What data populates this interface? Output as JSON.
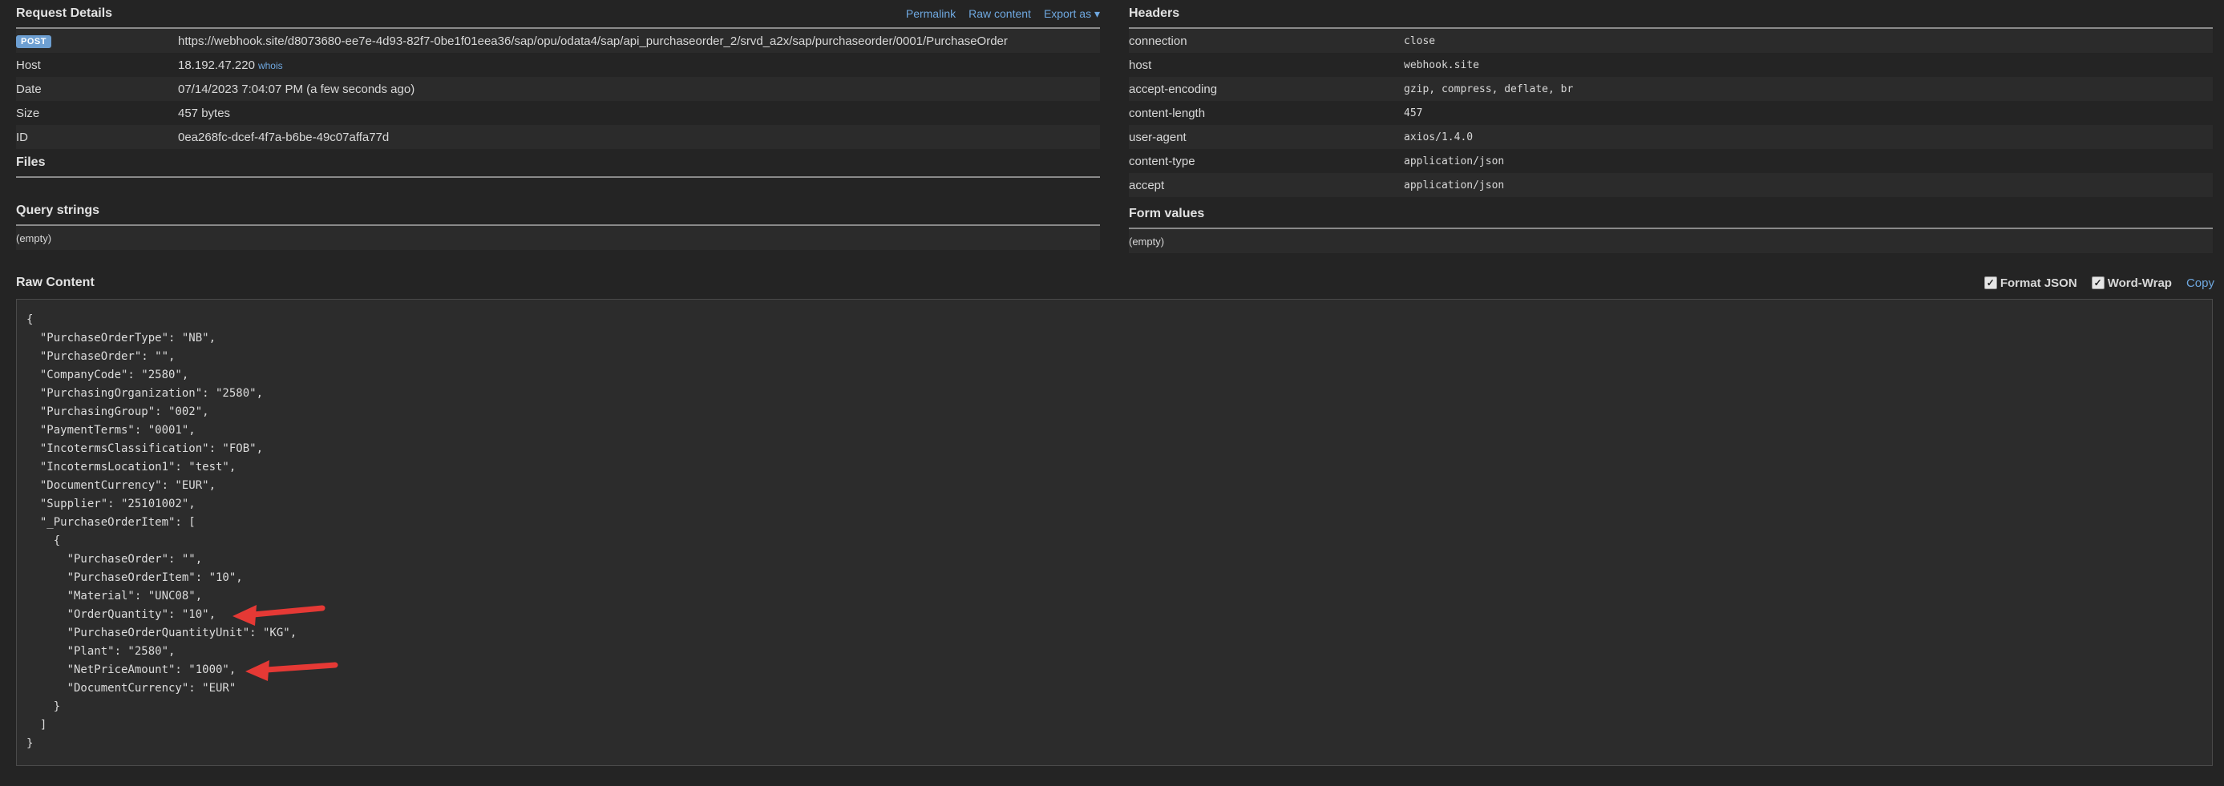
{
  "request": {
    "title": "Request Details",
    "actions": {
      "permalink": "Permalink",
      "raw_content": "Raw content",
      "export_as": "Export as ▾"
    },
    "method": "POST",
    "url": "https://webhook.site/d8073680-ee7e-4d93-82f7-0be1f01eea36/sap/opu/odata4/sap/api_purchaseorder_2/srvd_a2x/sap/purchaseorder/0001/PurchaseOrder",
    "rows": [
      {
        "label": "Host",
        "value": "18.192.47.220",
        "extra": "whois"
      },
      {
        "label": "Date",
        "value": "07/14/2023 7:04:07 PM (a few seconds ago)"
      },
      {
        "label": "Size",
        "value": "457 bytes"
      },
      {
        "label": "ID",
        "value": "0ea268fc-dcef-4f7a-b6be-49c07affa77d"
      }
    ]
  },
  "files": {
    "title": "Files"
  },
  "query_strings": {
    "title": "Query strings",
    "empty": "(empty)"
  },
  "headers": {
    "title": "Headers",
    "rows": [
      {
        "name": "connection",
        "value": "close"
      },
      {
        "name": "host",
        "value": "webhook.site"
      },
      {
        "name": "accept-encoding",
        "value": "gzip, compress, deflate, br"
      },
      {
        "name": "content-length",
        "value": "457"
      },
      {
        "name": "user-agent",
        "value": "axios/1.4.0"
      },
      {
        "name": "content-type",
        "value": "application/json"
      },
      {
        "name": "accept",
        "value": "application/json"
      }
    ]
  },
  "form_values": {
    "title": "Form values",
    "empty": "(empty)"
  },
  "raw": {
    "title": "Raw Content",
    "format_json": "Format JSON",
    "word_wrap": "Word-Wrap",
    "copy": "Copy",
    "body": "{\n  \"PurchaseOrderType\": \"NB\",\n  \"PurchaseOrder\": \"\",\n  \"CompanyCode\": \"2580\",\n  \"PurchasingOrganization\": \"2580\",\n  \"PurchasingGroup\": \"002\",\n  \"PaymentTerms\": \"0001\",\n  \"IncotermsClassification\": \"FOB\",\n  \"IncotermsLocation1\": \"test\",\n  \"DocumentCurrency\": \"EUR\",\n  \"Supplier\": \"25101002\",\n  \"_PurchaseOrderItem\": [\n    {\n      \"PurchaseOrder\": \"\",\n      \"PurchaseOrderItem\": \"10\",\n      \"Material\": \"UNC08\",\n      \"OrderQuantity\": \"10\",\n      \"PurchaseOrderQuantityUnit\": \"KG\",\n      \"Plant\": \"2580\",\n      \"NetPriceAmount\": \"1000\",\n      \"DocumentCurrency\": \"EUR\"\n    }\n  ]\n}"
  },
  "colors": {
    "accent": "#6fa8e0",
    "arrow": "#e53935",
    "badge": "#6d9fd2"
  }
}
